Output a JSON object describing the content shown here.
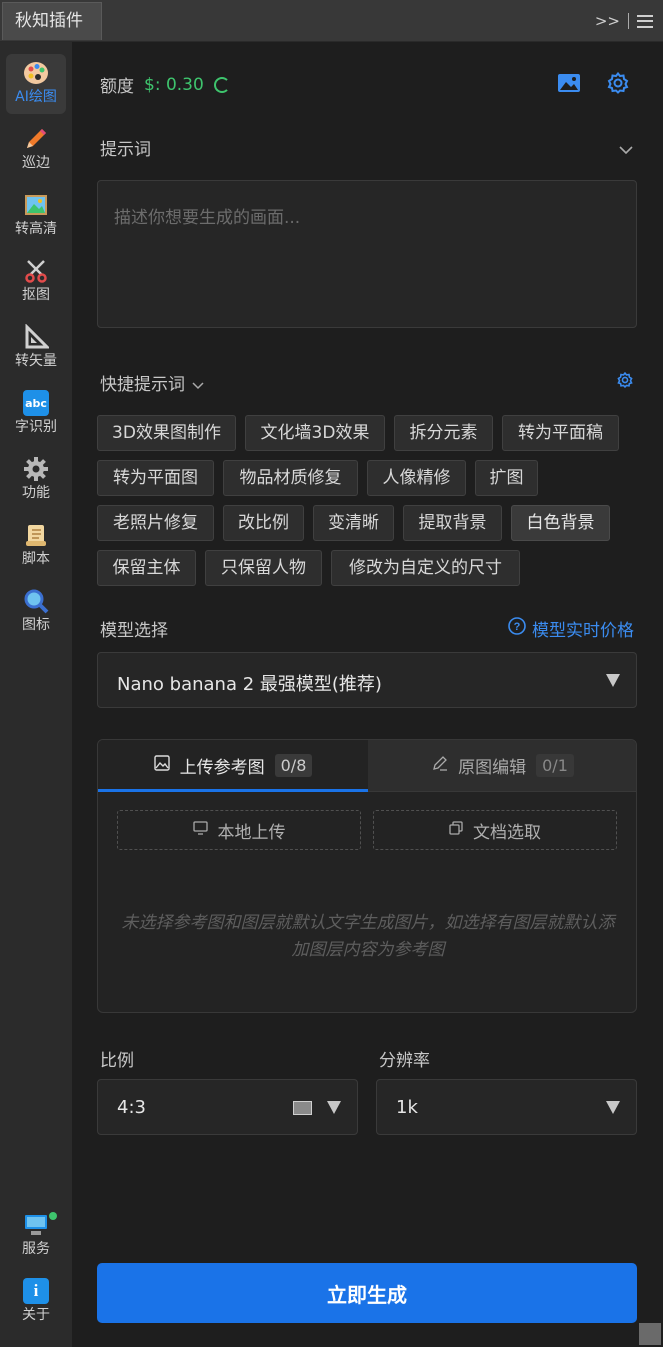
{
  "titlebar": {
    "tab": "秋知插件",
    "expand": ">>"
  },
  "sidebar": {
    "items": [
      {
        "label": "AI绘图",
        "icon": "palette-icon",
        "active": true
      },
      {
        "label": "巡边",
        "icon": "pencil-icon"
      },
      {
        "label": "转高清",
        "icon": "picture-icon"
      },
      {
        "label": "抠图",
        "icon": "scissors-icon"
      },
      {
        "label": "转矢量",
        "icon": "triangle-ruler-icon"
      },
      {
        "label": "字识别",
        "icon": "abc-icon",
        "glyph": "abc"
      },
      {
        "label": "功能",
        "icon": "gear-icon"
      },
      {
        "label": "脚本",
        "icon": "scroll-icon"
      },
      {
        "label": "图标",
        "icon": "magnifier-icon"
      }
    ],
    "bottom": [
      {
        "label": "服务",
        "icon": "computer-icon"
      },
      {
        "label": "关于",
        "icon": "info-icon",
        "glyph": "i"
      }
    ]
  },
  "credit": {
    "label": "额度",
    "currency": "$:",
    "value": "0.30"
  },
  "prompt": {
    "label": "提示词",
    "placeholder": "描述你想要生成的画面..."
  },
  "quick": {
    "label": "快捷提示词",
    "chips": [
      "3D效果图制作",
      "文化墙3D效果",
      "拆分元素",
      "转为平面稿",
      "转为平面图",
      "物品材质修复",
      "人像精修",
      "扩图",
      "老照片修复",
      "改比例",
      "变清晰",
      "提取背景",
      "白色背景",
      "保留主体",
      "只保留人物",
      "修改为自定义的尺寸"
    ]
  },
  "model": {
    "label": "模型选择",
    "price_link": "模型实时价格",
    "selected": "Nano banana 2 最强模型(推荐)"
  },
  "upload": {
    "tab_ref": "上传参考图",
    "tab_ref_count": "0/8",
    "tab_edit": "原图编辑",
    "tab_edit_count": "0/1",
    "local": "本地上传",
    "doc": "文档选取",
    "hint": "未选择参考图和图层就默认文字生成图片，如选择有图层就默认添加图层内容为参考图"
  },
  "ratio": {
    "label": "比例",
    "value": "4:3"
  },
  "resolution": {
    "label": "分辨率",
    "value": "1k"
  },
  "generate": "立即生成",
  "colors": {
    "accent": "#1a73e8",
    "credit": "#3ec46d",
    "link": "#3b8cf0"
  }
}
